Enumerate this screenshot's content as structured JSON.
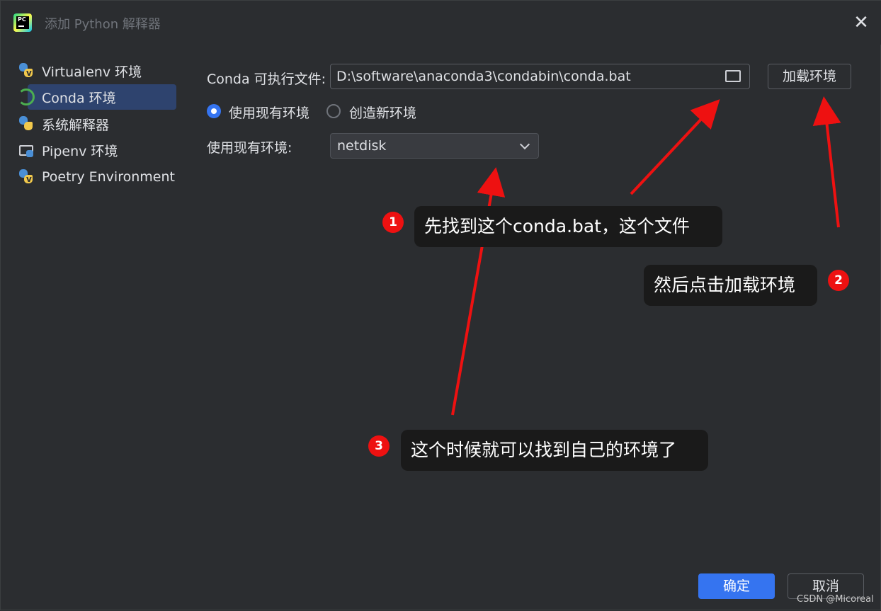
{
  "window": {
    "title": "添加 Python 解释器"
  },
  "sidebar": {
    "items": [
      {
        "label": "Virtualenv 环境",
        "icon": "python-venv-icon"
      },
      {
        "label": "Conda 环境",
        "icon": "conda-icon",
        "selected": true
      },
      {
        "label": "系统解释器",
        "icon": "python-icon"
      },
      {
        "label": "Pipenv 环境",
        "icon": "pipenv-folder-icon"
      },
      {
        "label": "Poetry Environment",
        "icon": "poetry-icon"
      }
    ]
  },
  "form": {
    "conda_label": "Conda 可执行文件:",
    "conda_path": "D:\\software\\anaconda3\\condabin\\conda.bat",
    "load_button": "加载环境",
    "radio_existing": "使用现有环境",
    "radio_new": "创造新环境",
    "existing_env_label": "使用现有环境:",
    "existing_env_value": "netdisk"
  },
  "annotations": [
    {
      "number": "1",
      "text": "先找到这个conda.bat，这个文件"
    },
    {
      "number": "2",
      "text": "然后点击加载环境"
    },
    {
      "number": "3",
      "text": "这个时候就可以找到自己的环境了"
    }
  ],
  "footer": {
    "ok": "确定",
    "cancel": "取消"
  },
  "watermark": "CSDN @Micoreal",
  "colors": {
    "accent": "#3574f0",
    "background": "#2b2d30",
    "selection": "#2e436e",
    "arrow": "#ee1111"
  }
}
